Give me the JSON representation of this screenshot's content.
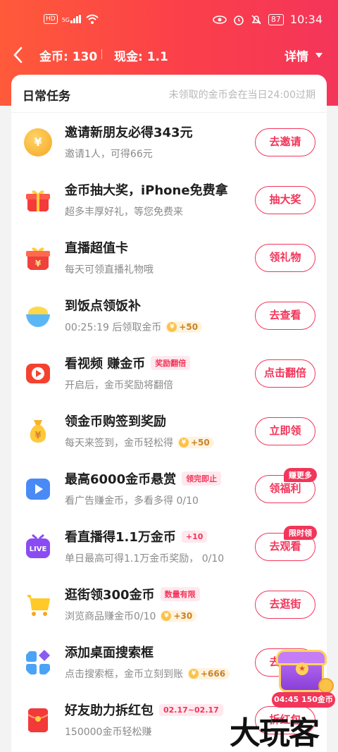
{
  "status_bar": {
    "hd": "HD",
    "signal": "5G",
    "battery": "87",
    "time": "10:34"
  },
  "nav": {
    "coin_label": "金币: 130",
    "cash_label": "现金: 1.1",
    "detail_label": "详情"
  },
  "card": {
    "title": "日常任务",
    "note": "未领取的金币会在当日24:00过期"
  },
  "tasks": [
    {
      "title": "邀请新朋友必得343元",
      "sub": "邀请1人，可得66元",
      "button": "去邀请",
      "icon": "coin-icon"
    },
    {
      "title": "金币抽大奖，iPhone免费拿",
      "sub": "超多丰厚好礼，等您免费来",
      "button": "抽大奖",
      "icon": "gift-icon"
    },
    {
      "title": "直播超值卡",
      "sub": "每天可领直播礼物哦",
      "button": "领礼物",
      "icon": "red-gift-icon"
    },
    {
      "title": "到饭点领饭补",
      "sub": "00:25:19 后领取金币",
      "pill": "+50",
      "button": "去查看",
      "icon": "rice-bowl-icon"
    },
    {
      "title": "看视频 赚金币",
      "tag": "奖励翻倍",
      "sub": "开启后，金币奖励将翻倍",
      "button": "点击翻倍",
      "icon": "video-play-icon"
    },
    {
      "title": "领金币购签到奖励",
      "sub": "每天来签到，金币轻松得",
      "pill": "+50",
      "button": "立即领",
      "icon": "money-bag-icon"
    },
    {
      "title": "最高6000金币悬赏",
      "tag": "领完即止",
      "sub": "看广告赚金币，多看多得 0/10",
      "button": "领福利",
      "badge": "赚更多",
      "icon": "ad-play-icon"
    },
    {
      "title": "看直播得1.1万金币",
      "tag": "+10",
      "sub": "单日最高可得1.1万金币奖励， 0/10",
      "button": "去观看",
      "badge": "限时领",
      "icon": "live-tv-icon"
    },
    {
      "title": "逛街领300金币",
      "tag": "数量有限",
      "sub": "浏览商品赚金币0/10",
      "pill": "+30",
      "button": "去逛街",
      "icon": "shopping-cart-icon"
    },
    {
      "title": "添加桌面搜索框",
      "sub": "点击搜索框，金币立刻到账",
      "pill": "+666",
      "button": "去添加",
      "icon": "widget-grid-icon"
    },
    {
      "title": "好友助力拆红包",
      "tag": "02.17~02.17",
      "sub": "150000金币轻松赚",
      "button": "拆红包",
      "icon": "red-envelope-icon"
    }
  ],
  "floating": {
    "timer": "04:45",
    "coins": "150金币"
  },
  "watermark": "大玩客",
  "colors": {
    "accent": "#f2355a",
    "header_start": "#ff5a3a",
    "header_end": "#f4355a"
  }
}
